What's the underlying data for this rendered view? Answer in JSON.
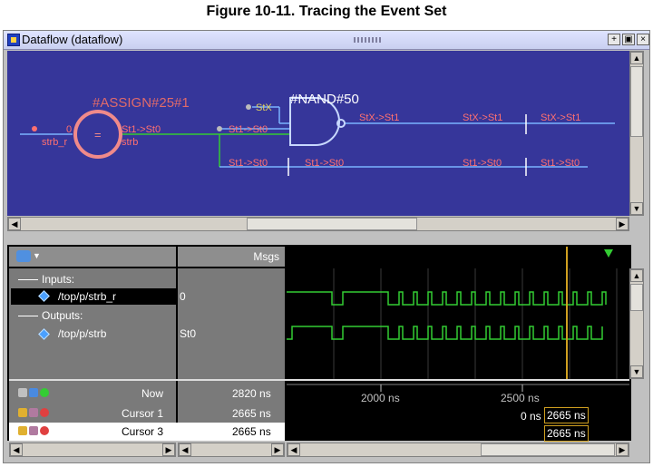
{
  "figure_caption": "Figure 10-11. Tracing the Event Set",
  "window": {
    "title": "Dataflow (dataflow)",
    "buttons": [
      "+",
      "▣",
      "×"
    ]
  },
  "dataflow": {
    "assign_label": "#ASSIGN#25#1",
    "nand_label": "#NAND#50",
    "assign_inner": "=",
    "in_value": "0",
    "in_name": "strb_r",
    "out_value": "St1->St0",
    "out_name": "strb",
    "stx": "StX",
    "branch1": "St1->St0",
    "branch2": "St1->St0",
    "branch2_b": "St1->St0",
    "nand_out": "StX->St1",
    "mid_top": "StX->St1",
    "right_top": "StX->St1",
    "mid_bot": "St1->St0",
    "right_bot": "St1->St0",
    "colors": {
      "canvas": "#36369a",
      "wire": "#7ab4ff",
      "green": "#33cc33",
      "label": "#ff7070"
    }
  },
  "wave": {
    "msgs_header": "Msgs",
    "groups": {
      "inputs": "Inputs:",
      "outputs": "Outputs:"
    },
    "signals": [
      {
        "name": "/top/p/strb_r",
        "value": "0"
      },
      {
        "name": "/top/p/strb",
        "value": "St0"
      }
    ],
    "now_label": "Now",
    "now_value": "2820 ns",
    "cursor1_label": "Cursor 1",
    "cursor1_value": "2665 ns",
    "cursor3_label": "Cursor 3",
    "cursor3_value": "2665 ns",
    "axis_ticks": [
      "2000 ns",
      "2500 ns"
    ],
    "cursor_delta": "0 ns",
    "cursor_box1": "2665 ns",
    "cursor_box2": "2665 ns"
  }
}
